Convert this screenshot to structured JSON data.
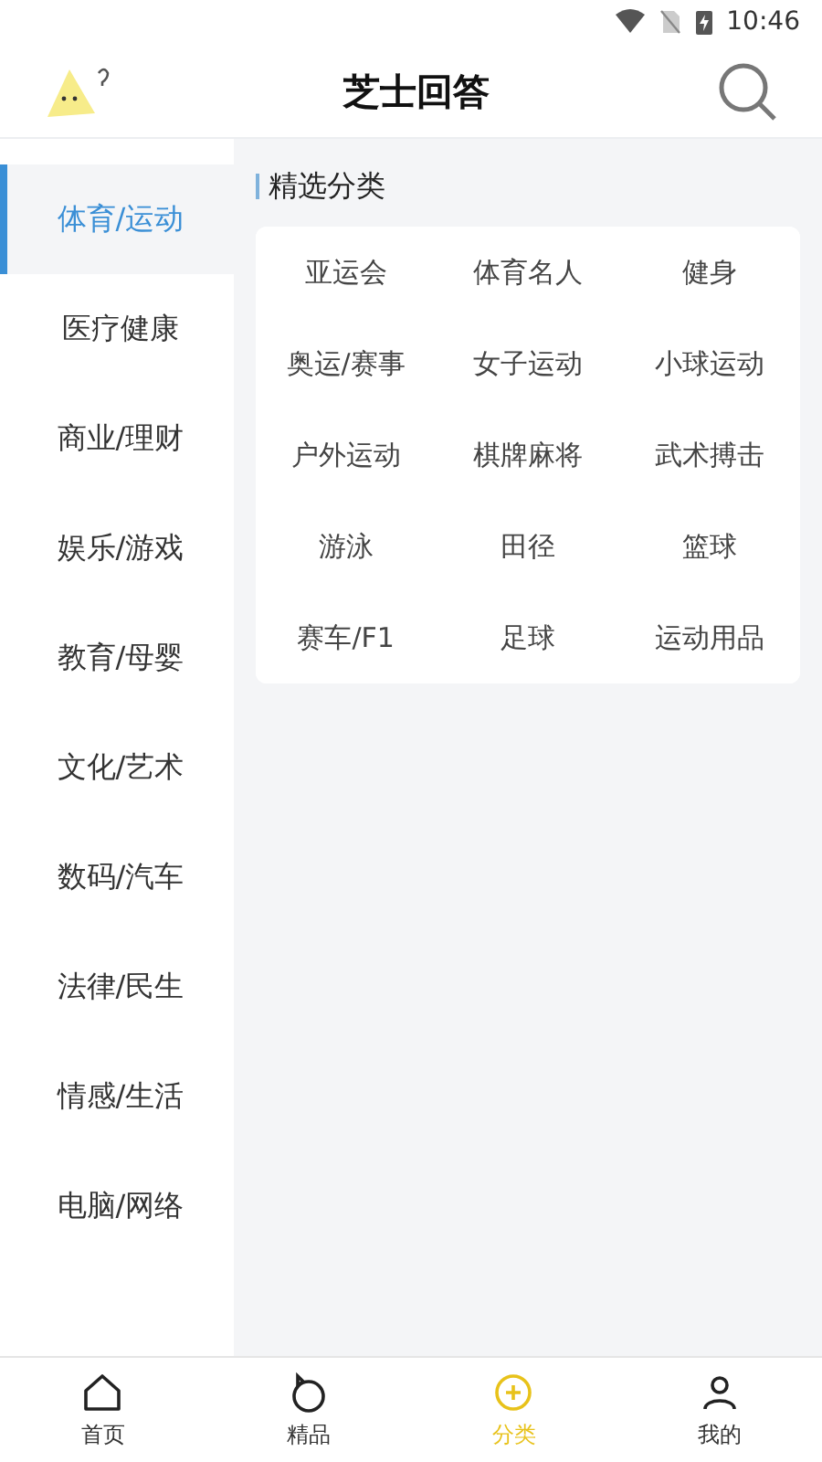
{
  "status_bar": {
    "time": "10:46"
  },
  "header": {
    "title": "芝士回答"
  },
  "sidebar": {
    "items": [
      {
        "label": "体育/运动",
        "selected": true
      },
      {
        "label": "医疗健康",
        "selected": false
      },
      {
        "label": "商业/理财",
        "selected": false
      },
      {
        "label": "娱乐/游戏",
        "selected": false
      },
      {
        "label": "教育/母婴",
        "selected": false
      },
      {
        "label": "文化/艺术",
        "selected": false
      },
      {
        "label": "数码/汽车",
        "selected": false
      },
      {
        "label": "法律/民生",
        "selected": false
      },
      {
        "label": "情感/生活",
        "selected": false
      },
      {
        "label": "电脑/网络",
        "selected": false
      }
    ]
  },
  "section": {
    "title": "精选分类",
    "items": [
      "亚运会",
      "体育名人",
      "健身",
      "奥运/赛事",
      "女子运动",
      "小球运动",
      "户外运动",
      "棋牌麻将",
      "武术搏击",
      "游泳",
      "田径",
      "篮球",
      "赛车/F1",
      "足球",
      "运动用品"
    ]
  },
  "bottom_nav": [
    {
      "kind": "home",
      "label": "首页",
      "selected": false
    },
    {
      "kind": "ring",
      "label": "精品",
      "selected": false
    },
    {
      "kind": "category",
      "label": "分类",
      "selected": true
    },
    {
      "kind": "me",
      "label": "我的",
      "selected": false
    }
  ]
}
